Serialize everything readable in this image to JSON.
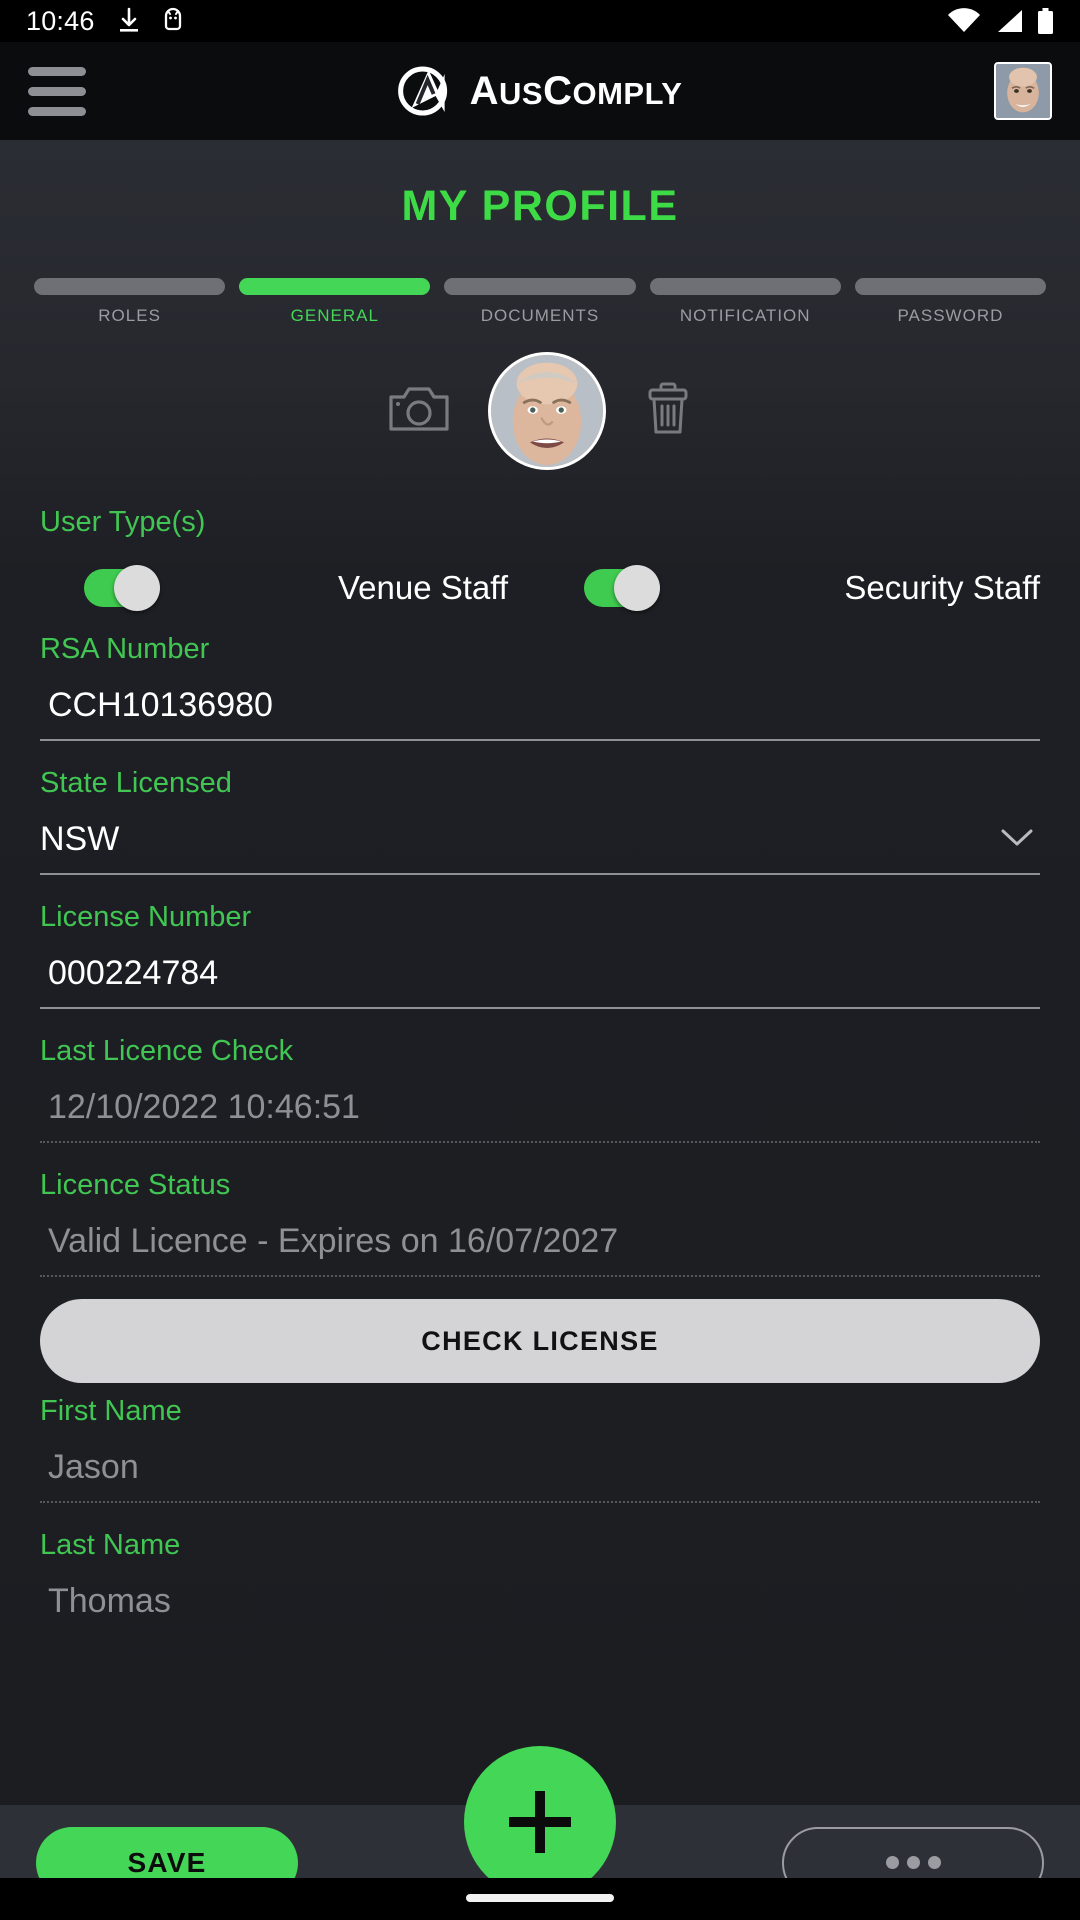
{
  "status_bar": {
    "time": "10:46",
    "icons": [
      "download-icon",
      "android-debug-icon",
      "wifi-icon",
      "cellular-signal-icon",
      "battery-icon"
    ]
  },
  "app_bar": {
    "menu_icon": "hamburger-menu-icon",
    "brand_main": "A",
    "brand_us": "US",
    "brand_c": "C",
    "brand_omply": "OMPLY",
    "brand_full": "AusComply",
    "avatar": "user-avatar"
  },
  "page": {
    "title": "MY PROFILE"
  },
  "steps": [
    {
      "label": "ROLES",
      "active": false
    },
    {
      "label": "GENERAL",
      "active": true
    },
    {
      "label": "DOCUMENTS",
      "active": false
    },
    {
      "label": "NOTIFICATION",
      "active": false
    },
    {
      "label": "PASSWORD",
      "active": false
    }
  ],
  "profile_photo": {
    "camera_icon": "camera-icon",
    "delete_icon": "trash-icon",
    "avatar": "profile-avatar"
  },
  "user_types": {
    "label": "User Type(s)",
    "options": [
      {
        "label": "Venue Staff",
        "enabled": true
      },
      {
        "label": "Security Staff",
        "enabled": true
      }
    ]
  },
  "fields": {
    "rsa_number": {
      "label": "RSA Number",
      "value": "CCH10136980"
    },
    "state_licensed": {
      "label": "State Licensed",
      "value": "NSW",
      "chevron": "chevron-down-icon"
    },
    "license_number": {
      "label": "License Number",
      "value": "000224784"
    },
    "last_licence_check": {
      "label": "Last Licence Check",
      "value": "12/10/2022 10:46:51"
    },
    "licence_status": {
      "label": "Licence Status",
      "value": "Valid Licence - Expires on 16/07/2027"
    },
    "first_name": {
      "label": "First Name",
      "value": "Jason"
    },
    "last_name": {
      "label": "Last Name",
      "value": "Thomas"
    }
  },
  "check_license_button": "CHECK LICENSE",
  "bottom_bar": {
    "save_label": "SAVE",
    "add_icon": "plus-icon",
    "more_icon": "ellipsis-icon"
  },
  "colors": {
    "accent_green": "#44d656",
    "label_green": "#41c653",
    "background": "#1d1f24",
    "appbar": "#0b0c0e",
    "muted_text": "#8e9096"
  }
}
